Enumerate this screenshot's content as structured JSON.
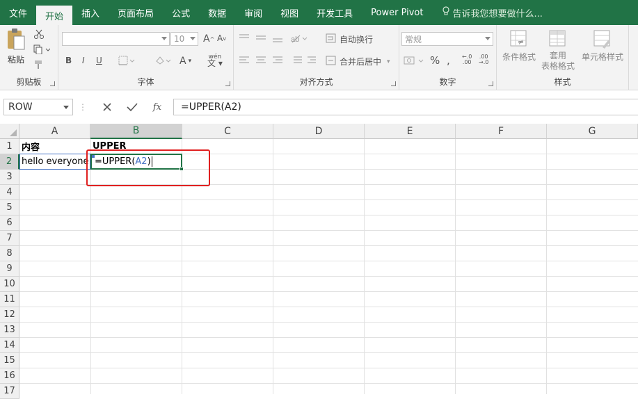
{
  "tabs": [
    "文件",
    "开始",
    "插入",
    "页面布局",
    "公式",
    "数据",
    "审阅",
    "视图",
    "开发工具",
    "Power Pivot"
  ],
  "active_tab": "开始",
  "tell_me": "告诉我您想要做什么...",
  "ribbon": {
    "clipboard": {
      "paste": "粘贴",
      "label": "剪贴板"
    },
    "font": {
      "size": "10",
      "label": "字体",
      "bold": "B",
      "italic": "I",
      "underline": "U"
    },
    "alignment": {
      "wrap": "自动换行",
      "merge": "合并后居中",
      "label": "对齐方式"
    },
    "number": {
      "format": "常规",
      "percent": "%",
      "label": "数字"
    },
    "styles": {
      "conditional": "条件格式",
      "table_format": "套用\n表格格式",
      "cell_style": "单元格样式",
      "label": "样式"
    }
  },
  "formula_bar": {
    "name_box": "ROW",
    "fx": "fx",
    "formula": "=UPPER(A2)"
  },
  "columns": [
    "A",
    "B",
    "C",
    "D",
    "E",
    "F",
    "G"
  ],
  "rows": [
    "1",
    "2",
    "3",
    "4",
    "5",
    "6",
    "7",
    "8",
    "9",
    "10",
    "11",
    "12",
    "13",
    "14",
    "15",
    "16",
    "17"
  ],
  "cells": {
    "A1": "内容",
    "B1": "UPPER",
    "A2": "hello everyone",
    "B2_prefix": "=UPPER(",
    "B2_ref": "A2",
    "B2_suffix": ")"
  }
}
